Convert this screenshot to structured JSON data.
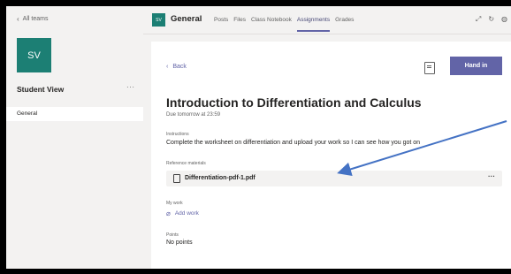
{
  "left": {
    "back_label": "All teams",
    "avatar_text": "SV",
    "team_name": "Student View",
    "more": "···",
    "channel": "General"
  },
  "topbar": {
    "avatar_text": "SV",
    "title": "General",
    "tabs": [
      "Posts",
      "Files",
      "Class Notebook",
      "Assignments",
      "Grades"
    ],
    "active_tab": "Assignments"
  },
  "assignment": {
    "back_label": "Back",
    "hand_in_label": "Hand in",
    "title": "Introduction to Differentiation and Calculus",
    "due": "Due tomorrow at 23:59",
    "instructions_label": "Instructions",
    "instructions_text": "Complete the worksheet on differentiation and upload your work so I can see how you got on",
    "reference_label": "Reference materials",
    "reference_file": "Differentiation-pdf-1.pdf",
    "reference_more": "···",
    "mywork_label": "My work",
    "add_work_label": "Add work",
    "points_label": "Points",
    "points_value": "No points"
  },
  "colors": {
    "accent": "#6264a7",
    "avatar": "#1c7f74",
    "annotation_arrow": "#4472c4"
  }
}
